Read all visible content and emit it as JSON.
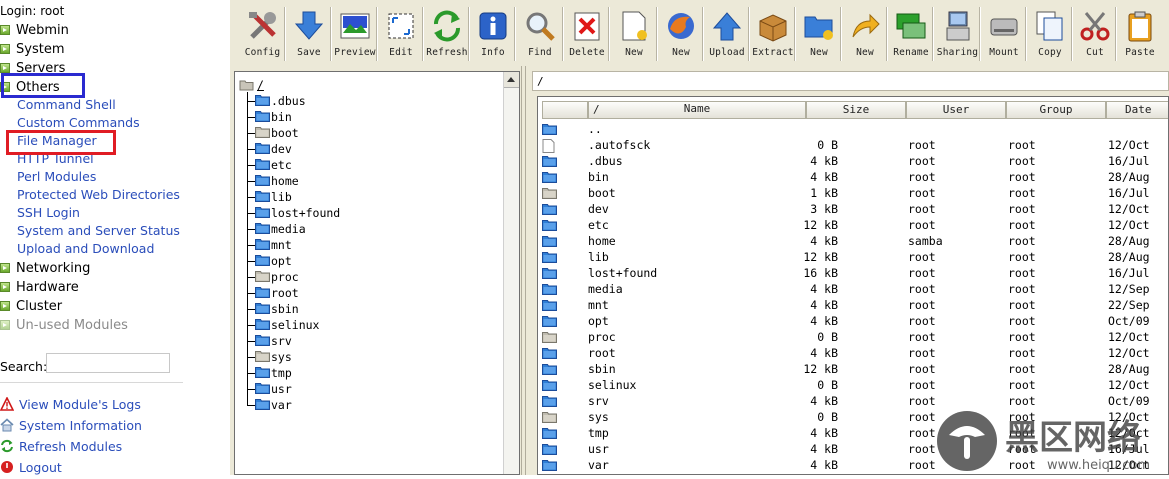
{
  "login": "Login: root",
  "categories": [
    {
      "label": "Webmin"
    },
    {
      "label": "System"
    },
    {
      "label": "Servers"
    },
    {
      "label": "Others"
    }
  ],
  "others_items": [
    "Command Shell",
    "Custom Commands",
    "File Manager",
    "HTTP Tunnel",
    "Perl Modules",
    "Protected Web Directories",
    "SSH Login",
    "System and Server Status",
    "Upload and Download"
  ],
  "more_categories": [
    {
      "label": "Networking"
    },
    {
      "label": "Hardware"
    },
    {
      "label": "Cluster"
    },
    {
      "label": "Un-used Modules"
    }
  ],
  "search": {
    "label": "Search:",
    "value": ""
  },
  "footer": [
    {
      "label": "View Module's Logs",
      "icon": "warning-icon"
    },
    {
      "label": "System Information",
      "icon": "house-icon"
    },
    {
      "label": "Refresh Modules",
      "icon": "refresh-icon"
    },
    {
      "label": "Logout",
      "icon": "logout-icon"
    }
  ],
  "toolbar": [
    {
      "label": "Config",
      "icon": "config-tools-icon"
    },
    {
      "label": "Save",
      "icon": "save-arrow-icon"
    },
    {
      "label": "Preview",
      "icon": "preview-image-icon"
    },
    {
      "label": "Edit",
      "icon": "edit-icon"
    },
    {
      "label": "Refresh",
      "icon": "refresh-icon"
    },
    {
      "label": "Info",
      "icon": "info-icon"
    },
    {
      "label": "Find",
      "icon": "find-magnifier-icon"
    },
    {
      "label": "Delete",
      "icon": "delete-x-icon"
    },
    {
      "label": "New",
      "icon": "new-file-icon"
    },
    {
      "label": "New",
      "icon": "new-browser-icon"
    },
    {
      "label": "Upload",
      "icon": "upload-arrow-icon"
    },
    {
      "label": "Extract",
      "icon": "extract-box-icon"
    },
    {
      "label": "New",
      "icon": "new-folder-icon"
    },
    {
      "label": "New",
      "icon": "new-link-arrow-icon"
    },
    {
      "label": "Rename",
      "icon": "rename-icon"
    },
    {
      "label": "Sharing",
      "icon": "sharing-computer-icon"
    },
    {
      "label": "Mount",
      "icon": "mount-drive-icon"
    },
    {
      "label": "Copy",
      "icon": "copy-icon"
    },
    {
      "label": "Cut",
      "icon": "cut-scissors-icon"
    },
    {
      "label": "Paste",
      "icon": "paste-clipboard-icon"
    }
  ],
  "tree": {
    "root": "/",
    "folders": [
      ".dbus",
      "bin",
      "boot",
      "dev",
      "etc",
      "home",
      "lib",
      "lost+found",
      "media",
      "mnt",
      "opt",
      "proc",
      "root",
      "sbin",
      "selinux",
      "srv",
      "sys",
      "tmp",
      "usr",
      "var"
    ]
  },
  "path": "/",
  "file_columns": [
    "/",
    "Name",
    "Size",
    "User",
    "Group",
    "Date"
  ],
  "files": [
    {
      "name": "..",
      "size": "",
      "user": "",
      "group": "",
      "date": "",
      "type": "folder"
    },
    {
      "name": ".autofsck",
      "size": "0 B",
      "user": "root",
      "group": "root",
      "date": "12/Oct",
      "type": "file"
    },
    {
      "name": ".dbus",
      "size": "4 kB",
      "user": "root",
      "group": "root",
      "date": "16/Jul",
      "type": "folder"
    },
    {
      "name": "bin",
      "size": "4 kB",
      "user": "root",
      "group": "root",
      "date": "28/Aug",
      "type": "folder"
    },
    {
      "name": "boot",
      "size": "1 kB",
      "user": "root",
      "group": "root",
      "date": "16/Jul",
      "type": "folder-gray"
    },
    {
      "name": "dev",
      "size": "3 kB",
      "user": "root",
      "group": "root",
      "date": "12/Oct",
      "type": "folder"
    },
    {
      "name": "etc",
      "size": "12 kB",
      "user": "root",
      "group": "root",
      "date": "12/Oct",
      "type": "folder"
    },
    {
      "name": "home",
      "size": "4 kB",
      "user": "samba",
      "group": "root",
      "date": "28/Aug",
      "type": "folder"
    },
    {
      "name": "lib",
      "size": "12 kB",
      "user": "root",
      "group": "root",
      "date": "28/Aug",
      "type": "folder"
    },
    {
      "name": "lost+found",
      "size": "16 kB",
      "user": "root",
      "group": "root",
      "date": "16/Jul",
      "type": "folder"
    },
    {
      "name": "media",
      "size": "4 kB",
      "user": "root",
      "group": "root",
      "date": "12/Sep",
      "type": "folder"
    },
    {
      "name": "mnt",
      "size": "4 kB",
      "user": "root",
      "group": "root",
      "date": "22/Sep",
      "type": "folder"
    },
    {
      "name": "opt",
      "size": "4 kB",
      "user": "root",
      "group": "root",
      "date": "Oct/09",
      "type": "folder"
    },
    {
      "name": "proc",
      "size": "0 B",
      "user": "root",
      "group": "root",
      "date": "12/Oct",
      "type": "folder-gray"
    },
    {
      "name": "root",
      "size": "4 kB",
      "user": "root",
      "group": "root",
      "date": "12/Oct",
      "type": "folder"
    },
    {
      "name": "sbin",
      "size": "12 kB",
      "user": "root",
      "group": "root",
      "date": "28/Aug",
      "type": "folder"
    },
    {
      "name": "selinux",
      "size": "0 B",
      "user": "root",
      "group": "root",
      "date": "12/Oct",
      "type": "folder"
    },
    {
      "name": "srv",
      "size": "4 kB",
      "user": "root",
      "group": "root",
      "date": "Oct/09",
      "type": "folder"
    },
    {
      "name": "sys",
      "size": "0 B",
      "user": "root",
      "group": "root",
      "date": "12/Oct",
      "type": "folder-gray"
    },
    {
      "name": "tmp",
      "size": "4 kB",
      "user": "root",
      "group": "root",
      "date": "12/Oct",
      "type": "folder"
    },
    {
      "name": "usr",
      "size": "4 kB",
      "user": "root",
      "group": "root",
      "date": "16/Jul",
      "type": "folder"
    },
    {
      "name": "var",
      "size": "4 kB",
      "user": "root",
      "group": "root",
      "date": "12/Oct",
      "type": "folder"
    }
  ],
  "watermark": {
    "text": "黑区网络",
    "url": "www.heiqu.com"
  },
  "colors": {
    "link": "#2a4dba",
    "highlight_blue": "#2a2ad0",
    "highlight_red": "#e01c24",
    "folder_blue": "#2f7fd6"
  }
}
